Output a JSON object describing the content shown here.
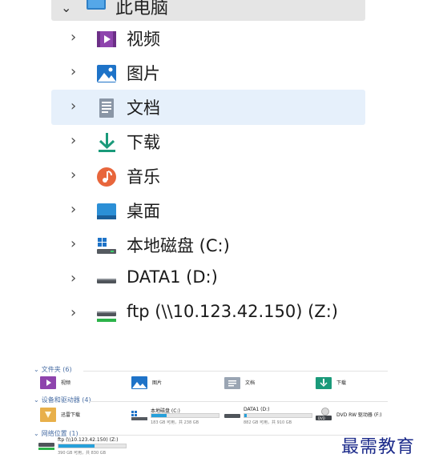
{
  "tree": {
    "root_label": "此电脑",
    "items": [
      {
        "label": "视频",
        "icon": "video-icon"
      },
      {
        "label": "图片",
        "icon": "picture-icon"
      },
      {
        "label": "文档",
        "icon": "document-icon",
        "selected": true
      },
      {
        "label": "下载",
        "icon": "download-icon"
      },
      {
        "label": "音乐",
        "icon": "music-icon"
      },
      {
        "label": "桌面",
        "icon": "desktop-icon"
      },
      {
        "label": "本地磁盘 (C:)",
        "icon": "windows-drive-icon"
      },
      {
        "label": "DATA1 (D:)",
        "icon": "drive-icon"
      },
      {
        "label": "ftp (\\\\10.123.42.150) (Z:)",
        "icon": "network-drive-icon"
      }
    ]
  },
  "lower": {
    "folders_header": "文件夹 (6)",
    "folders": [
      "视频",
      "图片",
      "文档",
      "下载"
    ],
    "devices_header": "设备和驱动器 (4)",
    "devices": [
      {
        "name": "迅雷下载"
      },
      {
        "name": "本地磁盘 (C:)",
        "size": "183 GB 可用，共 238 GB",
        "used_fraction": 0.23
      },
      {
        "name": "DATA1 (D:)",
        "size": "882 GB 可用，共 910 GB",
        "used_fraction": 0.03
      },
      {
        "name": "DVD RW 驱动器 (F:)"
      }
    ],
    "network_header": "网络位置 (1)",
    "network": [
      {
        "name": "ftp (\\\\10.123.42.150) (Z:)",
        "size": "390 GB 可用，共 830 GB",
        "used_fraction": 0.53
      }
    ]
  },
  "watermark": "最需教育",
  "colors": {
    "selection": "#e6f0fb",
    "accent": "#26a0da",
    "section_header": "#4a6fa5"
  }
}
